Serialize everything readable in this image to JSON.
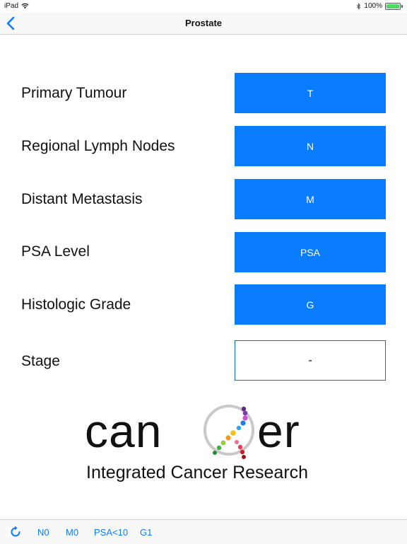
{
  "status": {
    "device": "iPad",
    "battery": "100%",
    "battery_level": 1.0
  },
  "nav": {
    "title": "Prostate"
  },
  "rows": [
    {
      "label": "Primary Tumour",
      "button": "T"
    },
    {
      "label": "Regional Lymph Nodes",
      "button": "N"
    },
    {
      "label": "Distant Metastasis",
      "button": "M"
    },
    {
      "label": "PSA Level",
      "button": "PSA"
    },
    {
      "label": "Histologic Grade",
      "button": "G"
    }
  ],
  "stage": {
    "label": "Stage",
    "value": "-"
  },
  "logo": {
    "word_left": "can",
    "word_right": "er",
    "subtitle": "Integrated Cancer Research"
  },
  "toolbar": {
    "items": [
      "N0",
      "M0",
      "PSA<10",
      "G1"
    ]
  },
  "colors": {
    "accent": "#0a7cff",
    "button_text": "#ffffff"
  },
  "icons": [
    "back-chevron-icon",
    "wifi-icon",
    "bluetooth-icon",
    "battery-icon",
    "refresh-icon"
  ]
}
